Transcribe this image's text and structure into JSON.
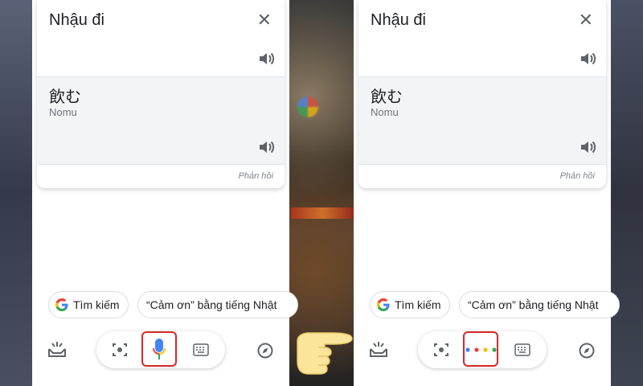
{
  "left_screen": {
    "source_text": "Nhậu đi",
    "target_text": "飲む",
    "romanization": "Nomu",
    "feedback": "Phản hồi",
    "chips": {
      "search": "Tìm kiếm",
      "phrase": "“Cảm ơn” bằng tiếng Nhật"
    },
    "input_mode": "microphone"
  },
  "right_screen": {
    "source_text": "Nhậu đi",
    "target_text": "飲む",
    "romanization": "Nomu",
    "feedback": "Phản hồi",
    "chips": {
      "search": "Tìm kiếm",
      "phrase": "“Cảm ơn” bằng tiếng Nhật"
    },
    "input_mode": "listening-dots"
  },
  "colors": {
    "highlight": "#d62828",
    "google_blue": "#4285f4",
    "google_red": "#ea4335",
    "google_yellow": "#fbbc05",
    "google_green": "#34a853"
  },
  "icons": [
    "close-icon",
    "speaker-icon",
    "google-g-icon",
    "updates-icon",
    "lens-icon",
    "mic-icon",
    "keyboard-icon",
    "compass-icon",
    "pointing-hand-icon"
  ]
}
